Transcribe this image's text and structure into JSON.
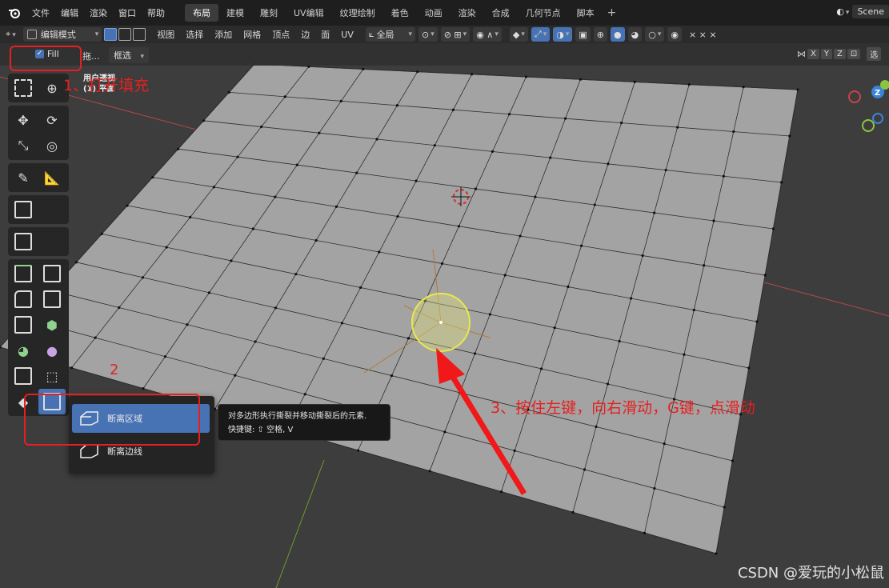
{
  "menu": [
    "文件",
    "编辑",
    "渲染",
    "窗口",
    "帮助"
  ],
  "workspaces": [
    "布局",
    "建模",
    "雕刻",
    "UV编辑",
    "纹理绘制",
    "着色",
    "动画",
    "渲染",
    "合成",
    "几何节点",
    "脚本"
  ],
  "active_workspace": "布局",
  "scene_label": "Scene",
  "toolbar": {
    "mode": "编辑模式",
    "items": [
      "视图",
      "选择",
      "添加",
      "网格",
      "顶点",
      "边",
      "面",
      "UV"
    ],
    "transform": "全局"
  },
  "header2": {
    "fill_label": "Fill",
    "drag_label": "拖...",
    "select_mode": "框选",
    "axes": [
      "X",
      "Y",
      "Z"
    ],
    "right_label": "选"
  },
  "viewport_info": {
    "line1": "用户透视",
    "line2": "(1) 平面"
  },
  "flyout": {
    "item1": "断离区域",
    "item2": "断离边线"
  },
  "tooltip": {
    "line1": "对多边形执行撕裂并移动撕裂后的元素.",
    "line2": "快捷键: ⇧ 空格, V"
  },
  "annotations": {
    "step1": "1、打开填充",
    "step2": "2",
    "step3": "3、按住左键，向右滑动，G键，点滑动"
  },
  "watermark": "CSDN @爱玩的小松鼠",
  "colors": {
    "accent": "#4772b3",
    "annotation": "#e62020",
    "mesh": "#a3a3a3",
    "brush": "#e8e84a"
  }
}
